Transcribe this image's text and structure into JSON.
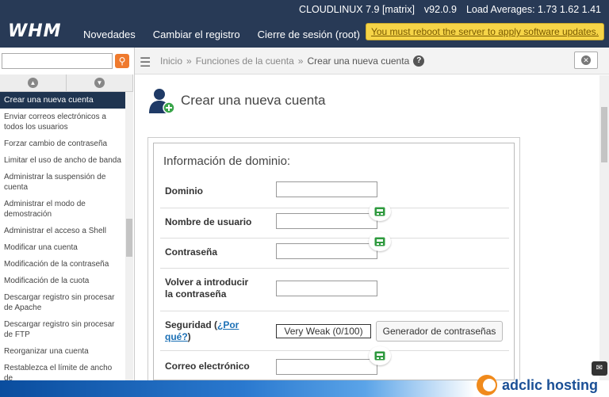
{
  "header": {
    "logo": "WHM",
    "nav": [
      "Novedades",
      "Cambiar el registro",
      "Cierre de sesión (root)"
    ],
    "server_name": "CLOUDLINUX 7.9 [matrix]",
    "version": "v92.0.9",
    "load_averages": "Load Averages: 1.73 1.62 1.41",
    "reboot_notice": "You must reboot the server to apply software updates."
  },
  "sidebar": {
    "search_placeholder": "",
    "items": [
      "Crear una nueva cuenta",
      "Enviar correos electrónicos a todos los usuarios",
      "Forzar cambio de contraseña",
      "Limitar el uso de ancho de banda",
      "Administrar la suspensión de cuenta",
      "Administrar el modo de demostración",
      "Administrar el acceso a Shell",
      "Modificar una cuenta",
      "Modificación de la contraseña",
      "Modificación de la cuota",
      "Descargar registro sin procesar de Apache",
      "Descargar registro sin procesar de FTP",
      "Reorganizar una cuenta",
      "Restablezca el límite de ancho de"
    ]
  },
  "breadcrumb": {
    "home": "Inicio",
    "section": "Funciones de la cuenta",
    "current": "Crear una nueva cuenta",
    "sep": "»",
    "help": "?"
  },
  "page": {
    "title": "Crear una nueva cuenta"
  },
  "form": {
    "section_title": "Información de dominio:",
    "domain_label": "Dominio",
    "username_label": "Nombre de usuario",
    "password_label": "Contraseña",
    "confirm_label_1": "Volver a introducir",
    "confirm_label_2": "la contraseña",
    "strength_label_prefix": "Seguridad (",
    "strength_link_1": "¿Por",
    "strength_link_2": "qué?",
    "strength_label_suffix": ")",
    "strength_value": "Very Weak (0/100)",
    "generator_button": "Generador de contraseñas",
    "email_label": "Correo electrónico"
  },
  "banner": {
    "brand": "adclic hosting"
  }
}
